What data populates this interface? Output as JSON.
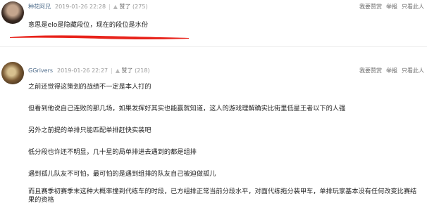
{
  "comments": [
    {
      "user": "种花阿兄",
      "time": "2019-01-26 22:28",
      "like_label": "赞了",
      "like_count": "(275)",
      "actions": [
        "我要赞赏",
        "举报",
        "只看此人"
      ],
      "lines": [
        "意思是elo是隐藏段位，现在的段位是水份"
      ]
    },
    {
      "user": "GGrivers",
      "time": "2019-01-26 22:27",
      "like_label": "赞了",
      "like_count": "(218)",
      "actions": [
        "我要赞赏",
        "举报",
        "只看此人"
      ],
      "lines": [
        "之前还觉得这策划的战绩不一定是本人打的",
        "但看到他说自己连败的那几场，如果发挥好其实也能赢就知道，这人的游戏理解确实比街里低星王者以下的人强",
        "另外之前提的单排只能匹配单排赶快实装吧",
        "低分段也许还不明显，几十星的局单排进去遇到的都是组排",
        "遇到孤儿队友不可怕，最可怕的是遇到组排的队友自己被迫做孤儿",
        "而且赛季初赛季末这种大概率撞到代练车的时段，已方组排正常当前分段水平，对面代练拖分装甲车，单排玩家基本没有任何改变比赛结果的资格"
      ]
    }
  ],
  "colors": {
    "username": "#4d6b8a",
    "meta": "#9a9a9a",
    "annotation": "#e8231b"
  }
}
